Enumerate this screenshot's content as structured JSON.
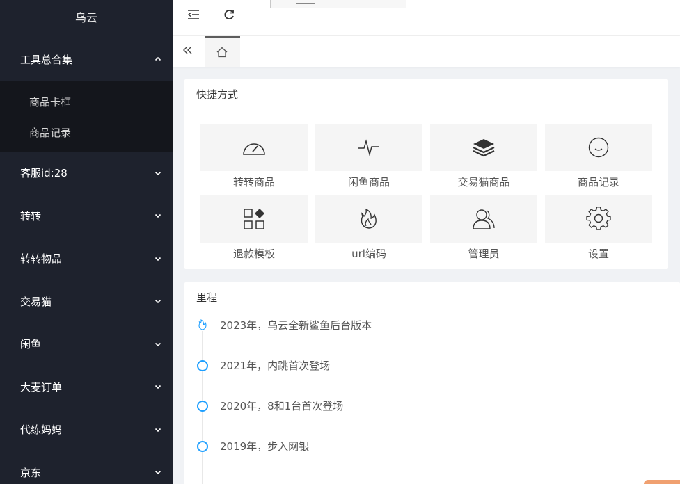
{
  "sidebar": {
    "logo": "乌云",
    "open_menu": {
      "label": "工具总合集",
      "children": [
        {
          "label": "商品卡框"
        },
        {
          "label": "商品记录"
        }
      ]
    },
    "items": [
      {
        "label": "客服id:28"
      },
      {
        "label": "转转"
      },
      {
        "label": "转转物品"
      },
      {
        "label": "交易猫"
      },
      {
        "label": "闲鱼"
      },
      {
        "label": "大麦订单"
      },
      {
        "label": "代练妈妈"
      },
      {
        "label": "京东"
      }
    ]
  },
  "topbar": {
    "menu_icon": "menu-fold-icon",
    "refresh_icon": "refresh-icon"
  },
  "tabs": {
    "collapse_icon": "double-chevron-left-icon",
    "home_icon": "home-icon"
  },
  "quick": {
    "title": "快捷方式",
    "items": [
      {
        "label": "转转商品",
        "icon": "dashboard-gauge-icon"
      },
      {
        "label": "闲鱼商品",
        "icon": "pulse-wave-icon"
      },
      {
        "label": "交易猫商品",
        "icon": "layers-stack-icon"
      },
      {
        "label": "商品记录",
        "icon": "smile-face-icon"
      },
      {
        "label": "退款模板",
        "icon": "apps-grid-icon"
      },
      {
        "label": "url编码",
        "icon": "flame-icon"
      },
      {
        "label": "管理员",
        "icon": "users-icon"
      },
      {
        "label": "设置",
        "icon": "gear-icon"
      }
    ]
  },
  "timeline": {
    "title": "里程",
    "items": [
      {
        "text": "2023年，乌云全新鲨鱼后台版本",
        "marker": "flame-icon"
      },
      {
        "text": "2021年，内跳首次登场",
        "marker": "circle"
      },
      {
        "text": "2020年，8和1台首次登场",
        "marker": "circle"
      },
      {
        "text": "2019年，步入网银",
        "marker": "circle"
      }
    ]
  },
  "colors": {
    "sidebar_bg": "#1e222d",
    "submenu_bg": "#14161c",
    "timeline_accent": "#1e9fff"
  }
}
